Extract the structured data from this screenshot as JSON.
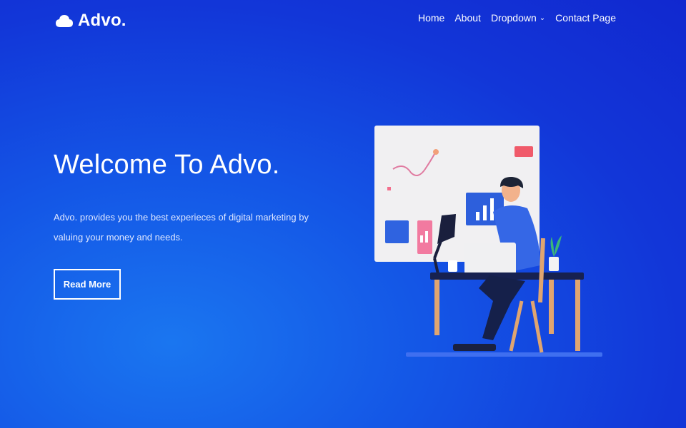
{
  "brand": {
    "name": "Advo.",
    "icon": "cloud-icon"
  },
  "nav": {
    "items": [
      {
        "label": "Home"
      },
      {
        "label": "About"
      },
      {
        "label": "Dropdown",
        "has_dropdown": true
      },
      {
        "label": "Contact Page"
      }
    ]
  },
  "hero": {
    "title": "Welcome To Advo.",
    "description": "Advo. provides you the best experieces of digital marketing by valuing your money and needs.",
    "button_label": "Read More"
  },
  "colors": {
    "background": "#1246dd",
    "text": "#ffffff",
    "accent_bar": "#3f6ff0"
  }
}
